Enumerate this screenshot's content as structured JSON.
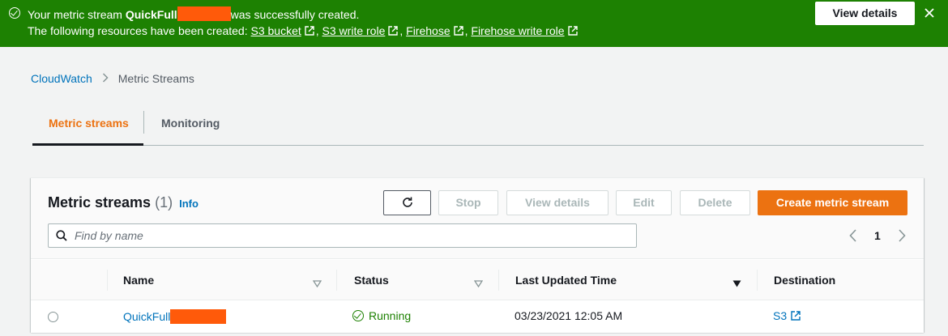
{
  "flash": {
    "message_prefix": "Your metric stream ",
    "stream_name": "QuickFull",
    "message_suffix": "was successfully created.",
    "resources_prefix": "The following resources have been created: ",
    "links": [
      "S3 bucket",
      "S3 write role",
      "Firehose",
      "Firehose write role"
    ],
    "view_details": "View details",
    "color": "#1d8102"
  },
  "breadcrumb": {
    "home": "CloudWatch",
    "current": "Metric Streams"
  },
  "tabs": [
    {
      "label": "Metric streams",
      "active": true
    },
    {
      "label": "Monitoring",
      "active": false
    }
  ],
  "panel": {
    "title": "Metric streams",
    "count": "(1)",
    "info": "Info",
    "buttons": {
      "stop": "Stop",
      "view_details": "View details",
      "edit": "Edit",
      "delete": "Delete",
      "create": "Create metric stream"
    },
    "search_placeholder": "Find by name",
    "page": "1",
    "accent": "#ec7211"
  },
  "table": {
    "columns": [
      "Name",
      "Status",
      "Last Updated Time",
      "Destination"
    ],
    "rows": [
      {
        "name": "QuickFull",
        "status": "Running",
        "updated": "03/23/2021 12:05 AM",
        "destination": "S3"
      }
    ]
  }
}
